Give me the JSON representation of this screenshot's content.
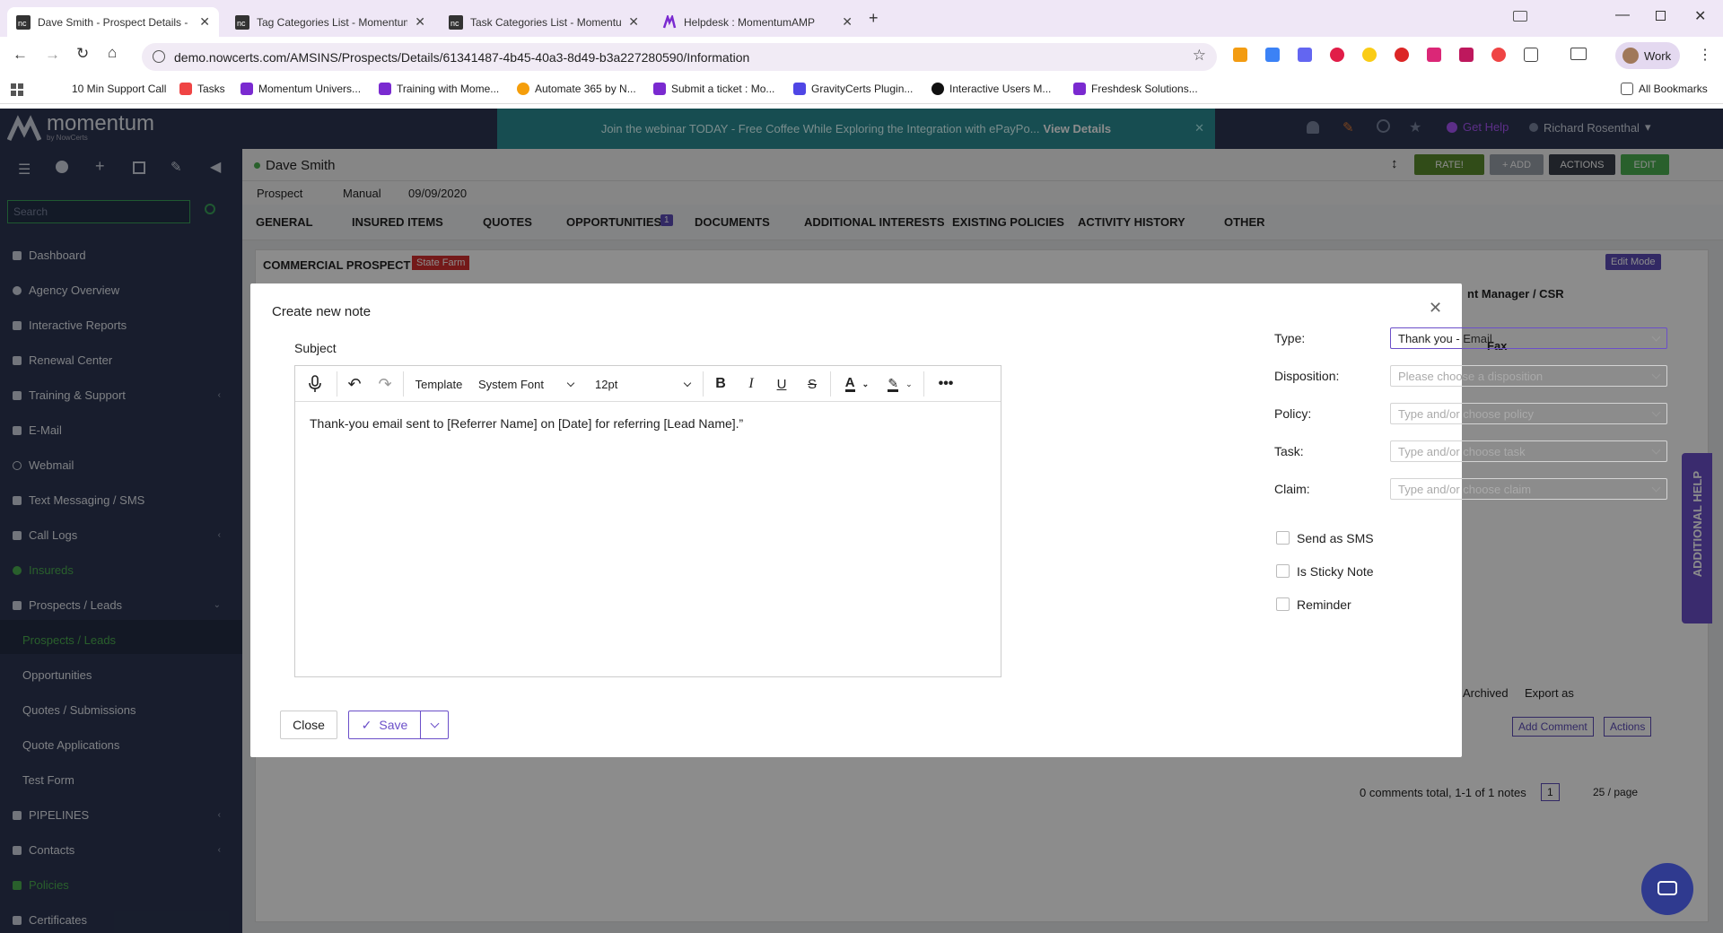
{
  "browser": {
    "tabs": [
      {
        "title": "Dave Smith - Prospect Details -",
        "icon": "nowcerts-icon",
        "active": true
      },
      {
        "title": "Tag Categories List - Momentum",
        "icon": "nowcerts-icon"
      },
      {
        "title": "Task Categories List - Momentum",
        "icon": "nowcerts-icon"
      },
      {
        "title": "Helpdesk : MomentumAMP",
        "icon": "momentum-icon"
      }
    ],
    "url": "demo.nowcerts.com/AMSINS/Prospects/Details/61341487-4b45-40a3-8d49-b3a227280590/Information",
    "profile_label": "Work",
    "bookmarks": [
      "10 Min Support Call",
      "Tasks",
      "Momentum Univers...",
      "Training with Mome...",
      "Automate 365 by N...",
      "Submit a ticket : Mo...",
      "GravityCerts Plugin...",
      "Interactive Users M...",
      "Freshdesk Solutions..."
    ],
    "all_bookmarks": "All Bookmarks"
  },
  "app": {
    "logo_text": "momentum",
    "logo_sub": "by NowCerts",
    "search_placeholder": "Search",
    "banner_text": "Join the webinar TODAY - Free Coffee While Exploring the Integration with ePayPo...",
    "banner_link": "View Details",
    "get_help": "Get Help",
    "user_name": "Richard Rosenthal",
    "sidebar": [
      {
        "label": "Dashboard"
      },
      {
        "label": "Agency Overview"
      },
      {
        "label": "Interactive Reports"
      },
      {
        "label": "Renewal Center"
      },
      {
        "label": "Training & Support"
      },
      {
        "label": "E-Mail"
      },
      {
        "label": "Webmail"
      },
      {
        "label": "Text Messaging / SMS"
      },
      {
        "label": "Call Logs"
      },
      {
        "label": "Insureds"
      },
      {
        "label": "Prospects / Leads"
      },
      {
        "label": "Prospects / Leads"
      },
      {
        "label": "Opportunities"
      },
      {
        "label": "Quotes / Submissions"
      },
      {
        "label": "Quote Applications"
      },
      {
        "label": "Test Form"
      },
      {
        "label": "PIPELINES"
      },
      {
        "label": "Contacts"
      },
      {
        "label": "Policies"
      },
      {
        "label": "Certificates"
      }
    ],
    "record": {
      "name": "Dave Smith",
      "status": "Prospect",
      "source": "Manual",
      "date": "09/09/2020",
      "buttons": {
        "rate": "RATE!",
        "add": "+ ADD",
        "actions": "ACTIONS",
        "edit": "EDIT"
      }
    },
    "tabs": [
      "GENERAL",
      "INSURED ITEMS",
      "QUOTES",
      "OPPORTUNITIES",
      "DOCUMENTS",
      "ADDITIONAL INTERESTS",
      "EXISTING POLICIES",
      "ACTIVITY HISTORY",
      "OTHER"
    ],
    "opportunities_count": "1",
    "section_title": "COMMERCIAL PROSPECT",
    "section_badge": "State Farm",
    "edit_mode": "Edit Mode",
    "bg_labels": {
      "account_manager": "nt Manager / CSR",
      "fax": "Fax",
      "archived": "Archived",
      "export_as": "Export as",
      "add_comment": "Add Comment",
      "actions": "Actions",
      "comments_total": "0 comments total, 1-1 of 1 notes",
      "page": "1",
      "per_page": "25 / page"
    },
    "additional_help": "ADDITIONAL HELP"
  },
  "modal": {
    "title": "Create new note",
    "subject_label": "Subject",
    "toolbar": {
      "template": "Template",
      "font": "System Font",
      "size": "12pt"
    },
    "body": "Thank-you email sent to [Referrer Name] on [Date] for referring [Lead Name].”",
    "fields": {
      "type_label": "Type:",
      "type_value": "Thank you - Email",
      "disposition_label": "Disposition:",
      "disposition_placeholder": "Please choose a disposition",
      "policy_label": "Policy:",
      "policy_placeholder": "Type and/or choose policy",
      "task_label": "Task:",
      "task_placeholder": "Type and/or choose task",
      "claim_label": "Claim:",
      "claim_placeholder": "Type and/or choose claim"
    },
    "checkboxes": [
      "Send as SMS",
      "Is Sticky Note",
      "Reminder"
    ],
    "close_label": "Close",
    "save_label": "Save"
  },
  "colors": {
    "sidebar": "#2c3652",
    "accent_green": "#4caf50",
    "banner": "#2b8c94",
    "primary": "#5b4bb7"
  }
}
